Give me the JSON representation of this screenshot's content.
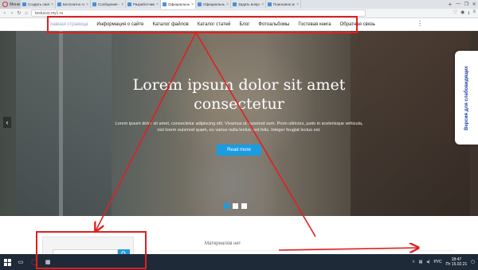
{
  "browser": {
    "menu_label": "Меню",
    "tabs": [
      {
        "title": "Создать свой сайт - uCoz",
        "active": false
      },
      {
        "title": "Бесплатно сайты - Дизайн",
        "active": false
      },
      {
        "title": "Сообщения - Служба по",
        "active": false
      },
      {
        "title": "Разработчики - Служба",
        "active": false
      },
      {
        "title": "Официальный сайт - Тест",
        "active": true
      },
      {
        "title": "Официальный сайт",
        "active": false
      },
      {
        "title": "Задать вопрос - uBoard",
        "active": false
      },
      {
        "title": "Поисковое изменения",
        "active": false
      }
    ],
    "url": "testucoz.my1.ru",
    "window_controls": [
      "—",
      "❐",
      "✕"
    ]
  },
  "site_nav": {
    "items": [
      "Главная страница",
      "Информация о сайте",
      "Каталог файлов",
      "Каталог статей",
      "Блог",
      "Фотоальбомы",
      "Гостевая книга",
      "Обратная связь"
    ],
    "more": "⋮"
  },
  "hero": {
    "title": "Lorem ipsum dolor sit amet consectetur",
    "text": "Lorem ipsum dolor sit amet, consectetur adipiscing elit. Vivamus ut euismod sem. Proin ultricies, justo in scelerisque vehicula, nisl lorem euismod quam, eu varius nulla lectus sed felis. Integer feugiat lectus est.",
    "button": "Read more",
    "prev_arrow": "‹",
    "slide_count": 3,
    "active_slide": 0
  },
  "accessibility_tab": "Версия для слабовидящих",
  "sidebar_widget": {
    "search_placeholder": ""
  },
  "content": {
    "empty_text": "Материалов нет"
  },
  "taskbar": {
    "lang": "РУС",
    "time": "18:47",
    "date": "Пт 15.02.21"
  },
  "colors": {
    "accent": "#1b9be0",
    "annotation": "#e02020",
    "access_text": "#1a3ea8"
  },
  "icons": [
    "opera-icon",
    "search-icon",
    "chevron-left-icon",
    "windows-logo-icon",
    "kebab-menu-icon"
  ]
}
